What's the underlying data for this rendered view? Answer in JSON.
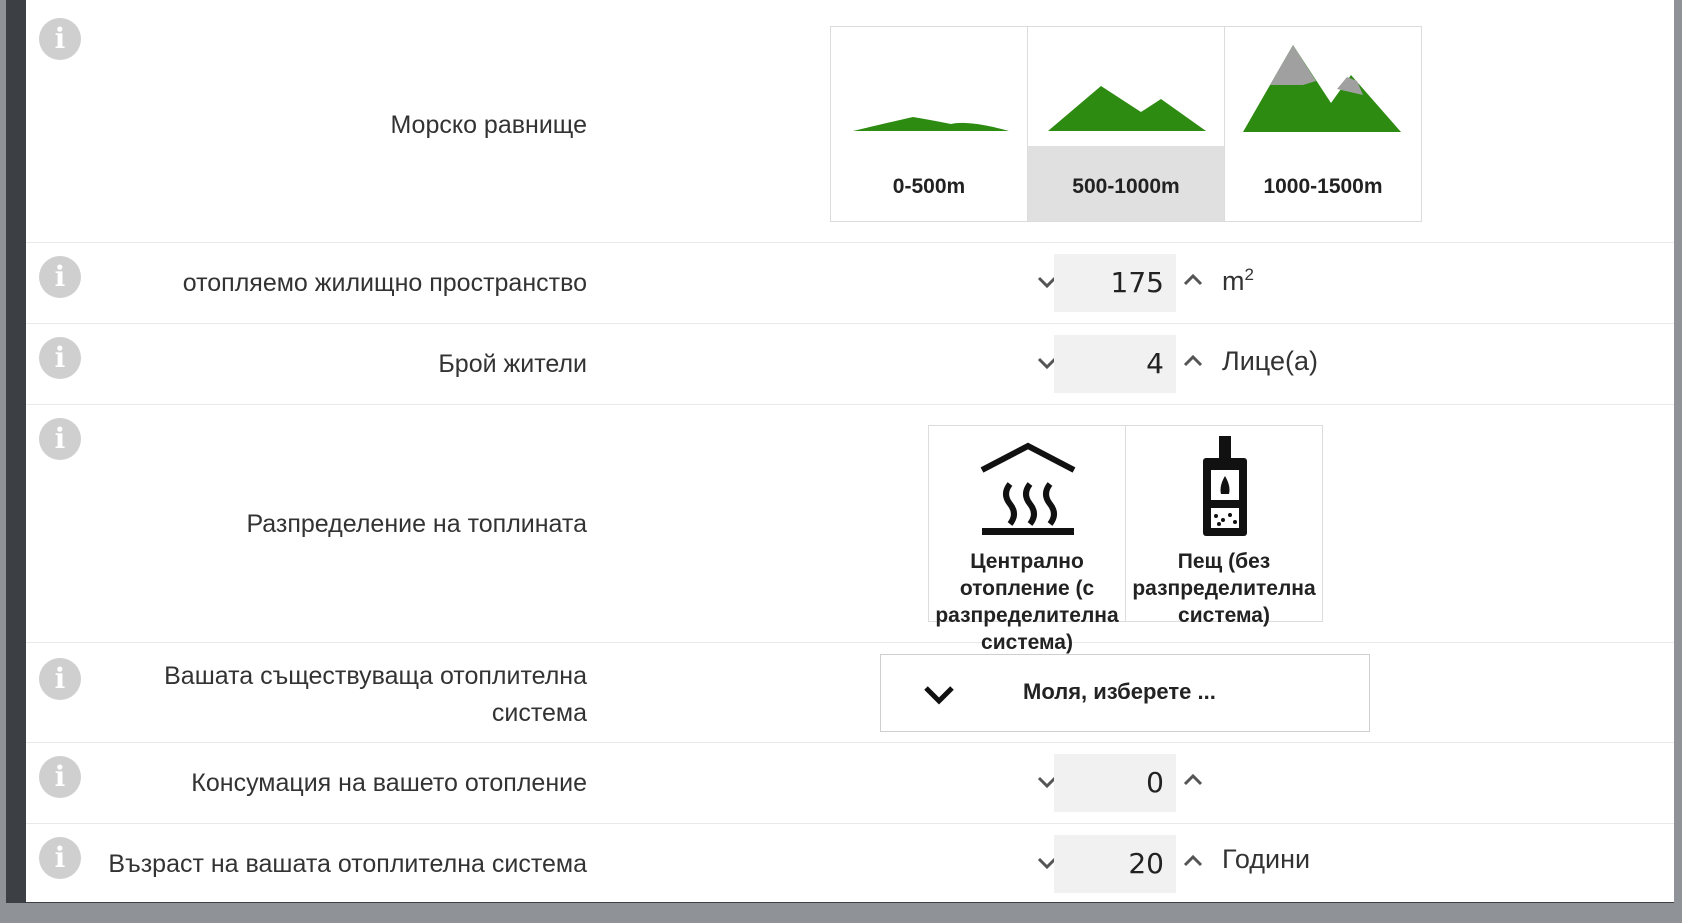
{
  "rows": {
    "altitude": {
      "label": "Морско равнище",
      "options": [
        {
          "label": "0-500m",
          "selected": false
        },
        {
          "label": "500-1000m",
          "selected": true
        },
        {
          "label": "1000-1500m",
          "selected": false
        }
      ]
    },
    "living_space": {
      "label": "отопляемо жилищно пространство",
      "value": "175",
      "unit": "m",
      "unit_sup": "2"
    },
    "residents": {
      "label": "Брой жители",
      "value": "4",
      "unit": "Лице(а)"
    },
    "heat_distribution": {
      "label": "Разпределение на топлината",
      "options": [
        {
          "label": "Централно отопление (с разпределителна система)",
          "icon": "central-heating-icon"
        },
        {
          "label": "Пещ (без разпределителна система)",
          "icon": "stove-icon"
        }
      ]
    },
    "existing_system": {
      "label": "Вашата съществуваща отоплителна система",
      "placeholder": "Моля, изберете ..."
    },
    "consumption": {
      "label": "Консумация на вашето отопление",
      "value": "0"
    },
    "system_age": {
      "label": "Възраст на вашата отоплителна система",
      "value": "20",
      "unit": "Години"
    }
  },
  "colors": {
    "mountain_green": "#2e8b12",
    "snow_gray": "#a0a0a0",
    "selected_bg": "#e0e0e0",
    "info_icon": "#cfcfcf"
  },
  "icons": {
    "info": "info-icon",
    "down": "chevron-down-icon",
    "up": "chevron-up-icon",
    "select": "chevron-down-icon"
  }
}
